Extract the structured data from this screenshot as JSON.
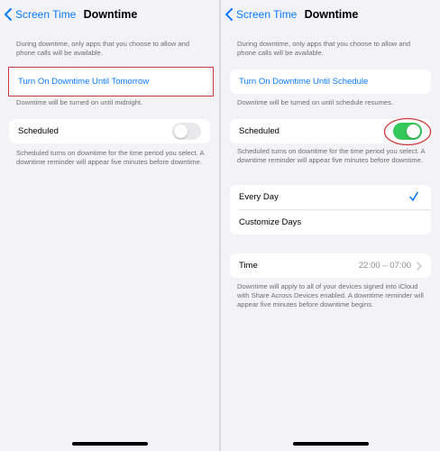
{
  "left": {
    "back_label": "Screen Time",
    "title": "Downtime",
    "intro": "During downtime, only apps that you choose to allow and phone calls will be available.",
    "turn_on_label": "Turn On Downtime Until Tomorrow",
    "turn_on_note": "Downtime will be turned on until midnight.",
    "scheduled_label": "Scheduled",
    "scheduled_on": false,
    "scheduled_note": "Scheduled turns on downtime for the time period you select. A downtime reminder will appear five minutes before downtime."
  },
  "right": {
    "back_label": "Screen Time",
    "title": "Downtime",
    "intro": "During downtime, only apps that you choose to allow and phone calls will be available.",
    "turn_on_label": "Turn On Downtime Until Schedule",
    "turn_on_note": "Downtime will be turned on until schedule resumes.",
    "scheduled_label": "Scheduled",
    "scheduled_on": true,
    "scheduled_note": "Scheduled turns on downtime for the time period you select. A downtime reminder will appear five minutes before downtime.",
    "every_day_label": "Every Day",
    "customize_days_label": "Customize Days",
    "time_label": "Time",
    "time_value": "22:00 – 07:00",
    "time_note": "Downtime will apply to all of your devices signed into iCloud with Share Across Devices enabled. A downtime reminder will appear five minutes before downtime begins."
  },
  "colors": {
    "accent": "#0a7aff",
    "toggle_on": "#34c759",
    "toggle_off": "#e9e9eb",
    "annotation": "#d03a3a",
    "background": "#f2f2f7"
  },
  "icons": [
    "chevron-left-icon",
    "checkmark-icon",
    "chevron-right-icon"
  ]
}
